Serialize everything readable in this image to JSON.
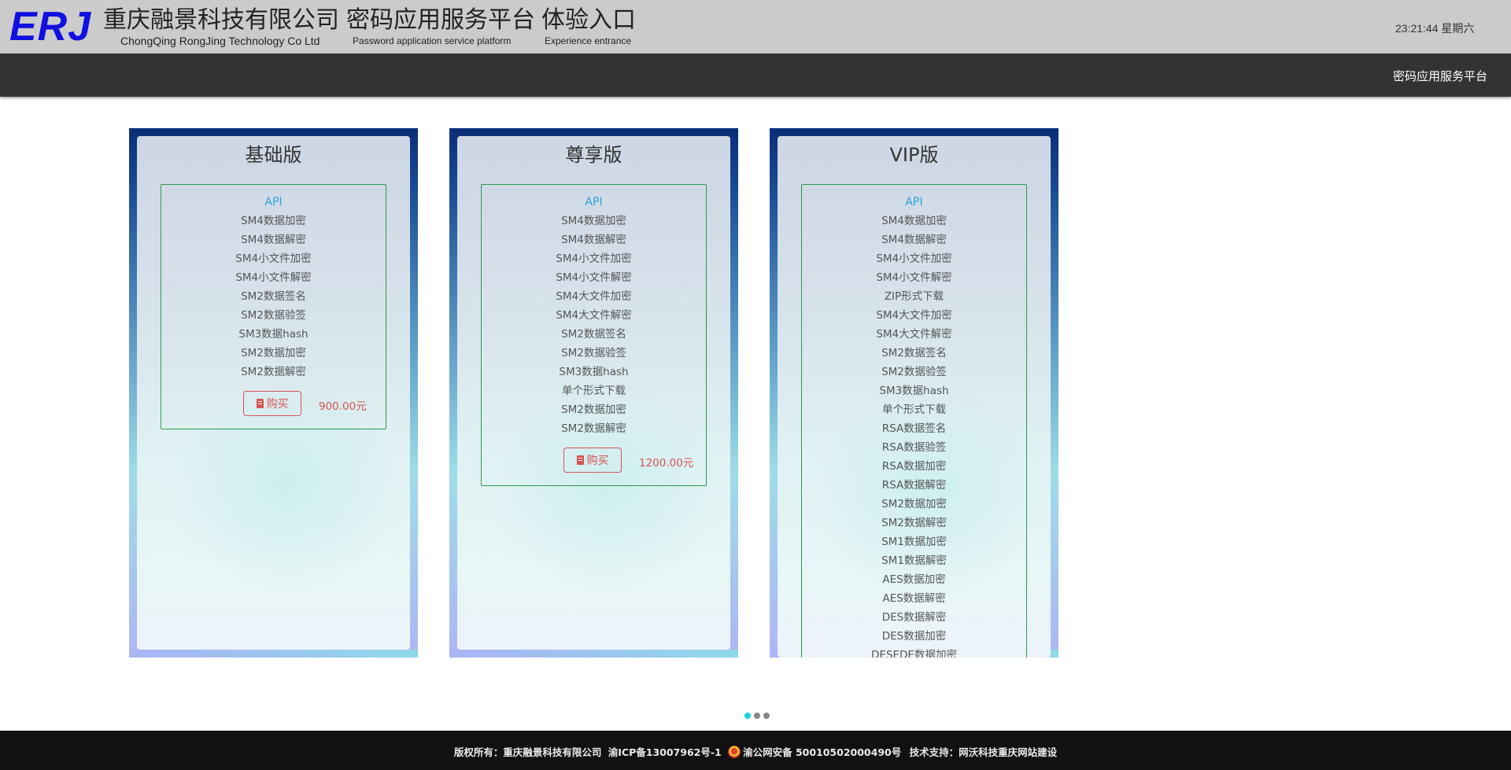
{
  "header": {
    "logo": "ERJ",
    "company_cn": "重庆融景科技有限公司",
    "company_en": "ChongQing RongJing Technology Co Ltd",
    "platform_cn": "密码应用服务平台",
    "platform_en": "Password application service platform",
    "entrance_cn": "体验入口",
    "entrance_en": "Experience entrance",
    "clock": "23:21:44 星期六"
  },
  "nav": {
    "link": "密码应用服务平台"
  },
  "plans": [
    {
      "title": "基础版",
      "api_label": "API",
      "items": [
        "SM4数据加密",
        "SM4数据解密",
        "SM4小文件加密",
        "SM4小文件解密",
        "SM2数据签名",
        "SM2数据验签",
        "SM3数据hash",
        "SM2数据加密",
        "SM2数据解密"
      ],
      "buy_label": "购买",
      "price": "900.00元"
    },
    {
      "title": "尊享版",
      "api_label": "API",
      "items": [
        "SM4数据加密",
        "SM4数据解密",
        "SM4小文件加密",
        "SM4小文件解密",
        "SM4大文件加密",
        "SM4大文件解密",
        "SM2数据签名",
        "SM2数据验签",
        "SM3数据hash",
        "单个形式下载",
        "SM2数据加密",
        "SM2数据解密"
      ],
      "buy_label": "购买",
      "price": "1200.00元"
    },
    {
      "title": "VIP版",
      "api_label": "API",
      "items": [
        "SM4数据加密",
        "SM4数据解密",
        "SM4小文件加密",
        "SM4小文件解密",
        "ZIP形式下载",
        "SM4大文件加密",
        "SM4大文件解密",
        "SM2数据签名",
        "SM2数据验签",
        "SM3数据hash",
        "单个形式下载",
        "RSA数据签名",
        "RSA数据验签",
        "RSA数据加密",
        "RSA数据解密",
        "SM2数据加密",
        "SM2数据解密",
        "SM1数据加密",
        "SM1数据解密",
        "AES数据加密",
        "AES数据解密",
        "DES数据解密",
        "DES数据加密",
        "DESEDE数据加密"
      ],
      "buy_label": "",
      "price": ""
    }
  ],
  "carousel": {
    "active_index": 0,
    "count": 3
  },
  "footer": {
    "copyright": "版权所有：重庆融景科技有限公司",
    "icp": "渝ICP备13007962号-1",
    "police": "渝公网安备 50010502000490号",
    "support": "技术支持：网沃科技重庆网站建设"
  }
}
